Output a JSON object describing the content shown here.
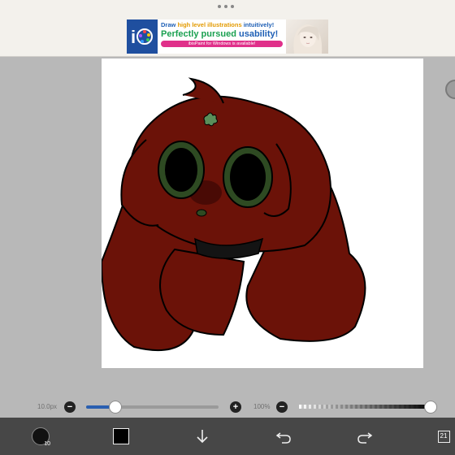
{
  "ad": {
    "line1_a": "Draw ",
    "line1_b": "high level illustrations",
    "line1_c": " intuitively!",
    "line2_a": "Perfectly pursued ",
    "line2_b": "usability!",
    "pill": "ibisPaint for Windows is available!"
  },
  "sliders": {
    "brush_size_label": "10.0px",
    "brush_size_fraction": 0.22,
    "opacity_label": "100%",
    "opacity_fraction": 1.0,
    "minus": "−",
    "plus": "+"
  },
  "toolbar": {
    "brush_size_value": "10",
    "layers_count": "21",
    "current_color": "#000000"
  },
  "icons": [
    "ibispaint-logo-icon",
    "brush-icon",
    "color-icon",
    "download-arrow-icon",
    "undo-icon",
    "redo-icon",
    "layers-icon"
  ]
}
